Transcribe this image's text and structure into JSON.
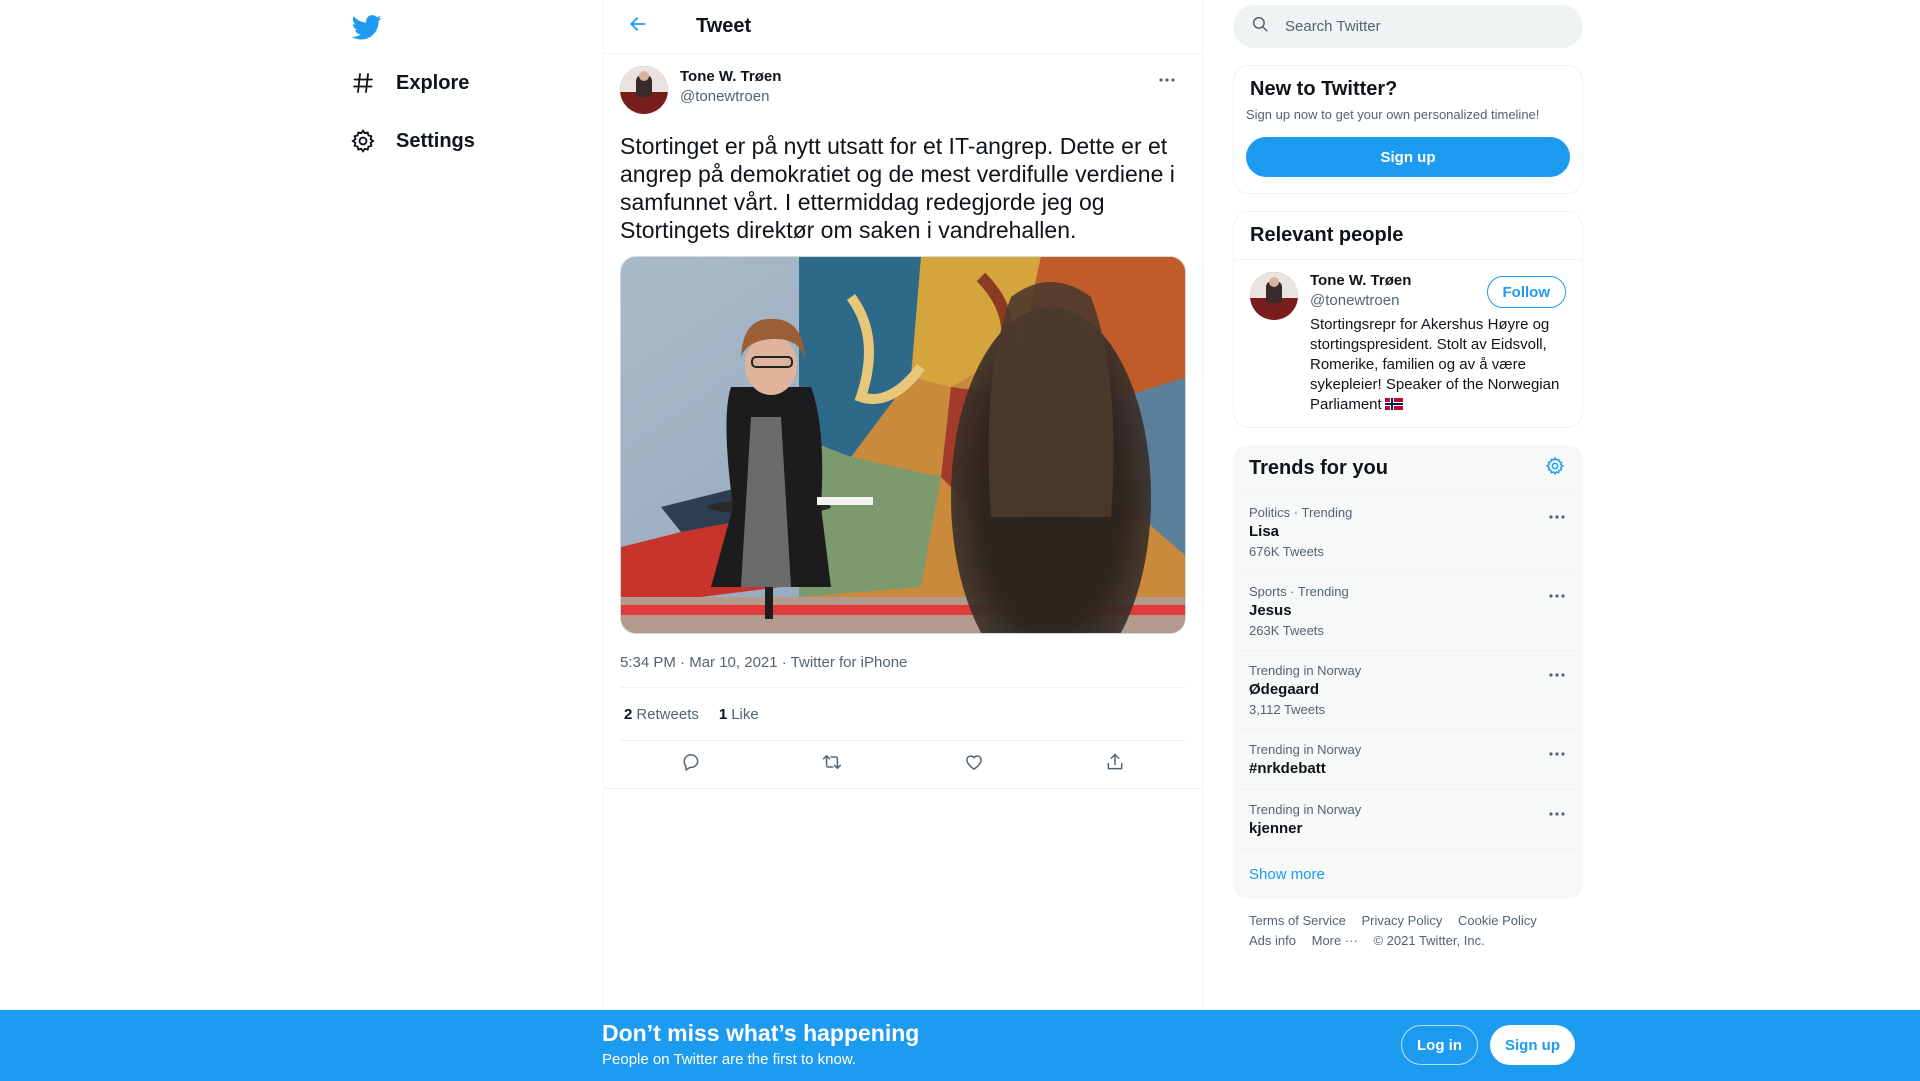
{
  "nav": {
    "logo_icon": "twitter-bird-icon",
    "items": [
      {
        "label": "Explore",
        "icon": "hashtag-icon"
      },
      {
        "label": "Settings",
        "icon": "gear-icon"
      }
    ]
  },
  "header": {
    "title": "Tweet",
    "back_icon": "arrow-left-icon"
  },
  "tweet": {
    "author_name": "Tone W. Trøen",
    "author_handle": "@tonewtroen",
    "text": "Stortinget er på nytt utsatt for et IT-angrep. Dette er et angrep på demokratiet og de mest verdifulle verdiene i samfunnet vårt. I ettermiddag redegjorde jeg og Stortingets direktør om saken i vandrehallen.",
    "time": "5:34 PM",
    "separator": " · ",
    "date": "Mar 10, 2021",
    "source": "Twitter for iPhone",
    "retweet_count": "2",
    "retweet_label": "Retweets",
    "like_count": "1",
    "like_label": "Like"
  },
  "search": {
    "placeholder": "Search Twitter"
  },
  "new_to_twitter": {
    "title": "New to Twitter?",
    "subtitle": "Sign up now to get your own personalized timeline!",
    "button": "Sign up"
  },
  "relevant": {
    "title": "Relevant people",
    "name": "Tone W. Trøen",
    "handle": "@tonewtroen",
    "bio": "Stortingsrepr for Akershus Høyre og stortingspresident. Stolt av Eidsvoll, Romerike, familien og av å være sykepleier! Speaker of the Norwegian Parliament",
    "follow": "Follow"
  },
  "trends": {
    "title": "Trends for you",
    "items": [
      {
        "category": "Politics · Trending",
        "name": "Lisa",
        "count": "676K Tweets"
      },
      {
        "category": "Sports · Trending",
        "name": "Jesus",
        "count": "263K Tweets"
      },
      {
        "category": "Trending in Norway",
        "name": "Ødegaard",
        "count": "3,112 Tweets"
      },
      {
        "category": "Trending in Norway",
        "name": "#nrkdebatt",
        "count": ""
      },
      {
        "category": "Trending in Norway",
        "name": "kjenner",
        "count": ""
      }
    ],
    "show_more": "Show more"
  },
  "footer": {
    "links": [
      "Terms of Service",
      "Privacy Policy",
      "Cookie Policy",
      "Ads info",
      "More ···",
      "© 2021 Twitter, Inc."
    ]
  },
  "bottom_bar": {
    "title": "Don’t miss what’s happening",
    "subtitle": "People on Twitter are the first to know.",
    "login": "Log in",
    "signup": "Sign up"
  },
  "colors": {
    "accent": "#1d9bf0",
    "text": "#0f1419",
    "secondary": "#536471"
  }
}
